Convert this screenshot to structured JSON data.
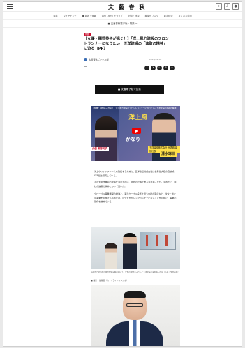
{
  "header": {
    "logo": "文 藝 春 秋",
    "nav_items": [
      "特集",
      "ダイヤモンド",
      "■ 新着・速報",
      "週刊 (月刊) ドライブ",
      "対談・連載",
      "編集長ブログ",
      "政治経済",
      "よくある質問"
    ],
    "icons": [
      "search-icon",
      "bell-icon",
      "user-icon"
    ]
  },
  "breadcrumb": "■ 文藝春秋電子版・特集 >",
  "article": {
    "badge": "対談",
    "headline": "【女優・剛野英子が訊く！】「洋上風力建設のフロントランナーになりたい」五洋建設の「進取の精神」に迫る（PR）",
    "author": "文藝春秋ビジネス部",
    "date": "2023/01/30",
    "share_icons": [
      "facebook-icon",
      "x-icon",
      "line-icon",
      "hatena-icon",
      "link-icon"
    ]
  },
  "cta": {
    "label": "■ 文春電子版で読む"
  },
  "video": {
    "title": "【女優・剛野英子が訊く】洋上風力建設のフロントランナーになりたい／五洋建設の進取の精神",
    "overlay_big": "洋上風",
    "overlay_mid": "かなり",
    "label_left": "女優 剛野英子",
    "label_right_small": "五洋建設株式会社 代表取締役社長",
    "label_right_name": "清水琢三"
  },
  "body": {
    "paragraph_1": "洋上ウインドファームを建設するために、五洋建設株式会社は世界最大級の自航式SEP船を保有している。",
    "paragraph_2": "その大型作業船の建造を決めたのは、同社の社長である清水琢三氏だ。清水氏に、同社の進取の精神について聞いた。",
    "paragraph_3": "グローバル事業展開の推進と、海洋ケーブル設置を担う会社の買収など、次々と新たな事業を手掛ける清水氏は、自分たちがトップランナーになることを目標に、事業の強化を進めている。"
  },
  "photo1": {
    "caption": "造船所で建造中の風力発電設備の前にて、女優の剛野英子さんと五洋建設の清水琢三社長（写真＝文藝春秋）"
  },
  "credit": "■ 撮影 / 佐藤亘（ムーンライトスタジオ）"
}
